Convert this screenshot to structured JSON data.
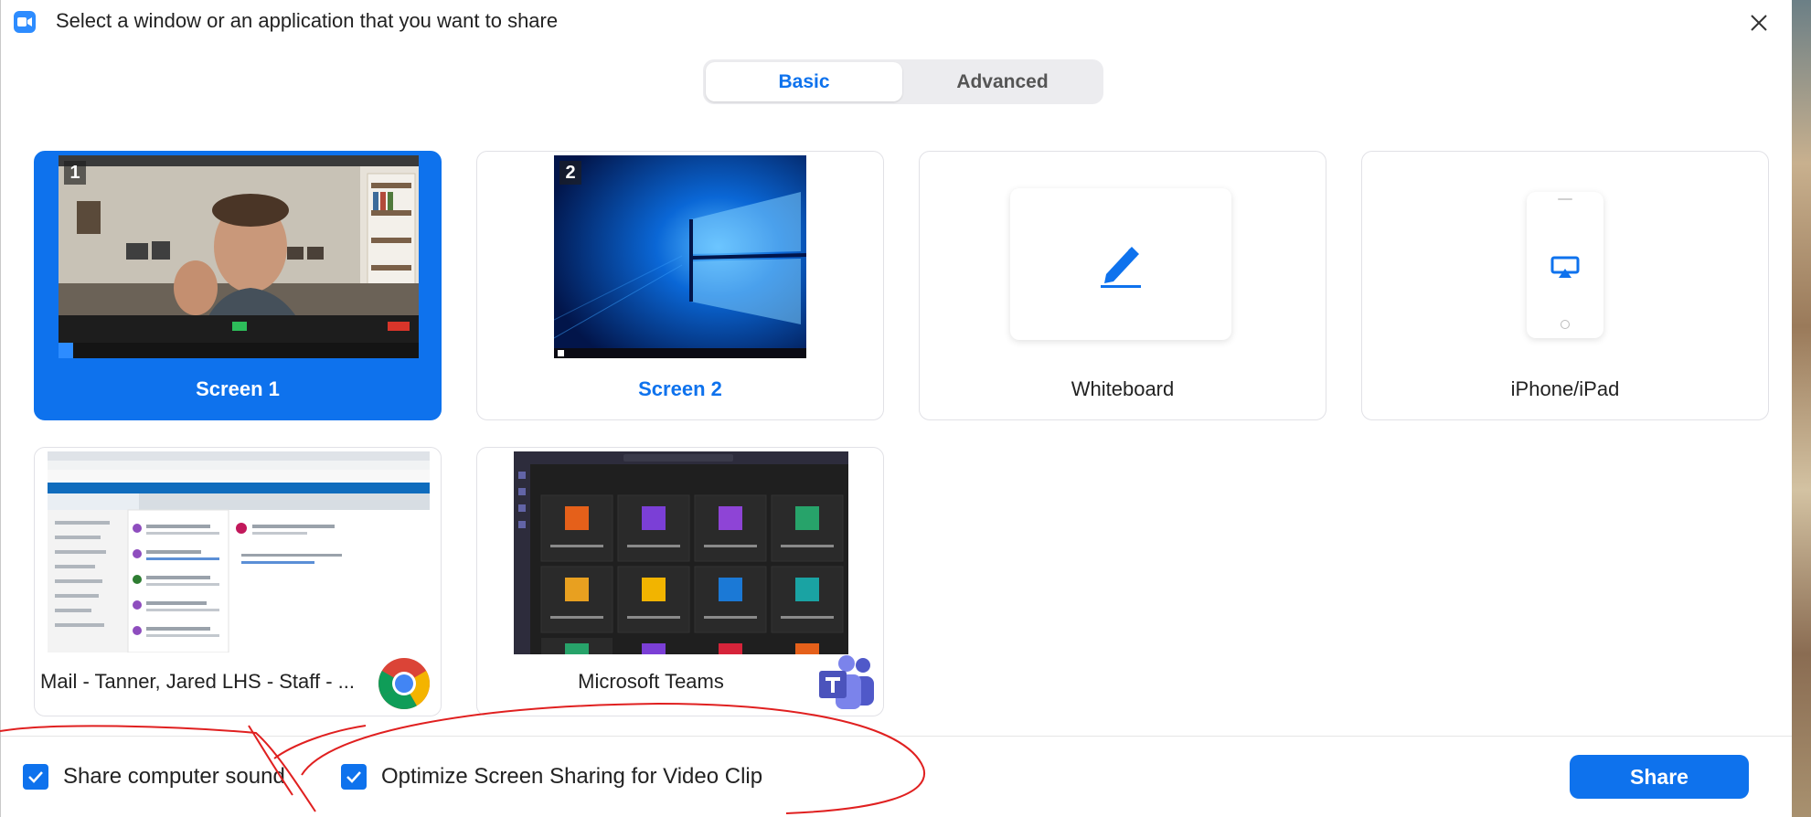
{
  "window": {
    "title": "Select a window or an application that you want to share"
  },
  "tabs": {
    "basic": "Basic",
    "advanced": "Advanced",
    "selected": "Basic"
  },
  "tiles": {
    "screen1": {
      "label": "Screen 1",
      "number": "1"
    },
    "screen2": {
      "label": "Screen 2",
      "number": "2"
    },
    "whiteboard": {
      "label": "Whiteboard"
    },
    "iphone": {
      "label": "iPhone/iPad"
    },
    "mail": {
      "label": "Mail - Tanner, Jared LHS - Staff - ..."
    },
    "teams": {
      "label": "Microsoft Teams"
    }
  },
  "options": {
    "share_sound": {
      "label": "Share computer sound",
      "checked": true
    },
    "optimize_video": {
      "label": "Optimize Screen Sharing for Video Clip",
      "checked": true
    }
  },
  "actions": {
    "share_label": "Share"
  },
  "colors": {
    "accent": "#0e72ed",
    "annotation": "#e02020"
  },
  "icons": {
    "app": "zoom-icon",
    "close": "close-icon",
    "whiteboard": "pencil-icon",
    "iphone": "airplay-icon",
    "mail_app": "chrome-icon",
    "teams_app": "teams-icon",
    "check": "check-icon"
  }
}
